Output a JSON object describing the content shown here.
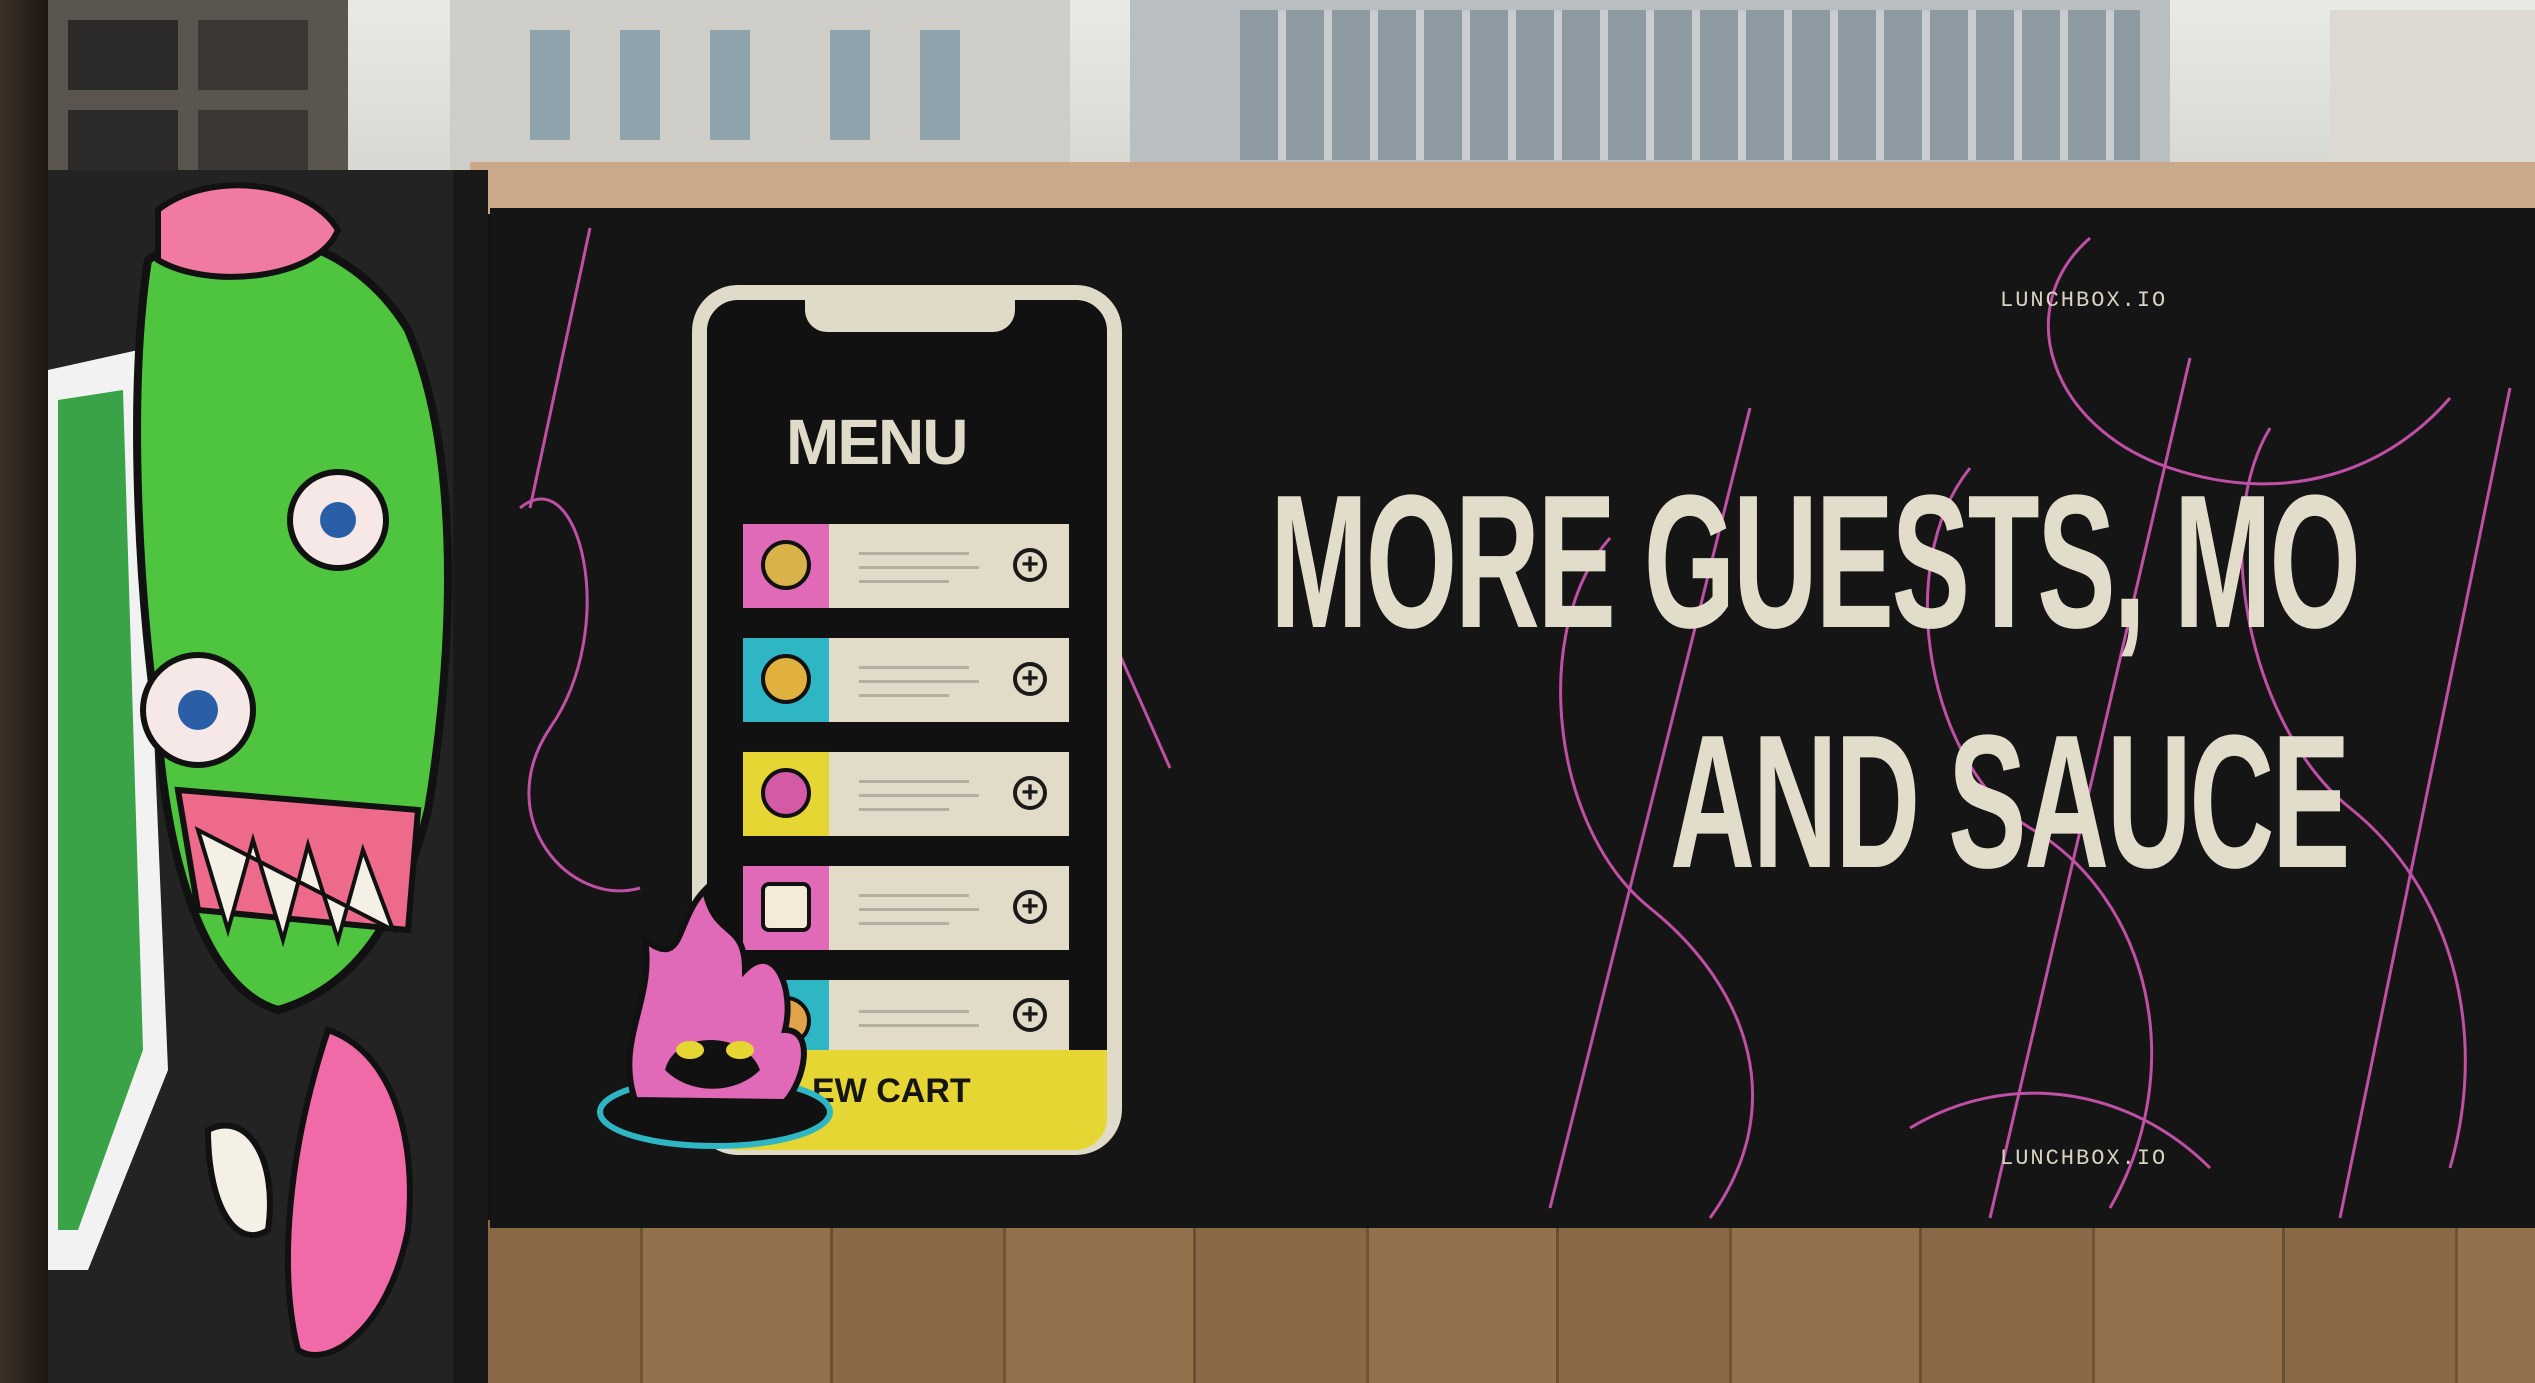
{
  "poster": {
    "domain_top": "LUNCHBOX.IO",
    "domain_bottom": "LUNCHBOX.IO",
    "headline_line1": "MORE GUESTS, MO",
    "headline_line2": "AND SAUCE"
  },
  "phone_mockup": {
    "title": "MENU",
    "items": [
      {
        "icon": "burger-icon",
        "swatch_color": "#e06ab8"
      },
      {
        "icon": "taco-icon",
        "swatch_color": "#2fb6c4"
      },
      {
        "icon": "noodle-bowl-icon",
        "swatch_color": "#e6d633"
      },
      {
        "icon": "coffee-cup-icon",
        "swatch_color": "#e06ab8"
      },
      {
        "icon": "pizza-slice-icon",
        "swatch_color": "#2fb6c4"
      }
    ],
    "add_icon": "plus-circle-icon",
    "cart_label": "EW CART"
  },
  "colors": {
    "poster_background": "#161515",
    "poster_text": "#e2dccb",
    "contour_lines": "#c04fa6",
    "cart_yellow": "#e6d633",
    "graffiti_green": "#3fbf3a",
    "graffiti_pink": "#f06aa8"
  }
}
